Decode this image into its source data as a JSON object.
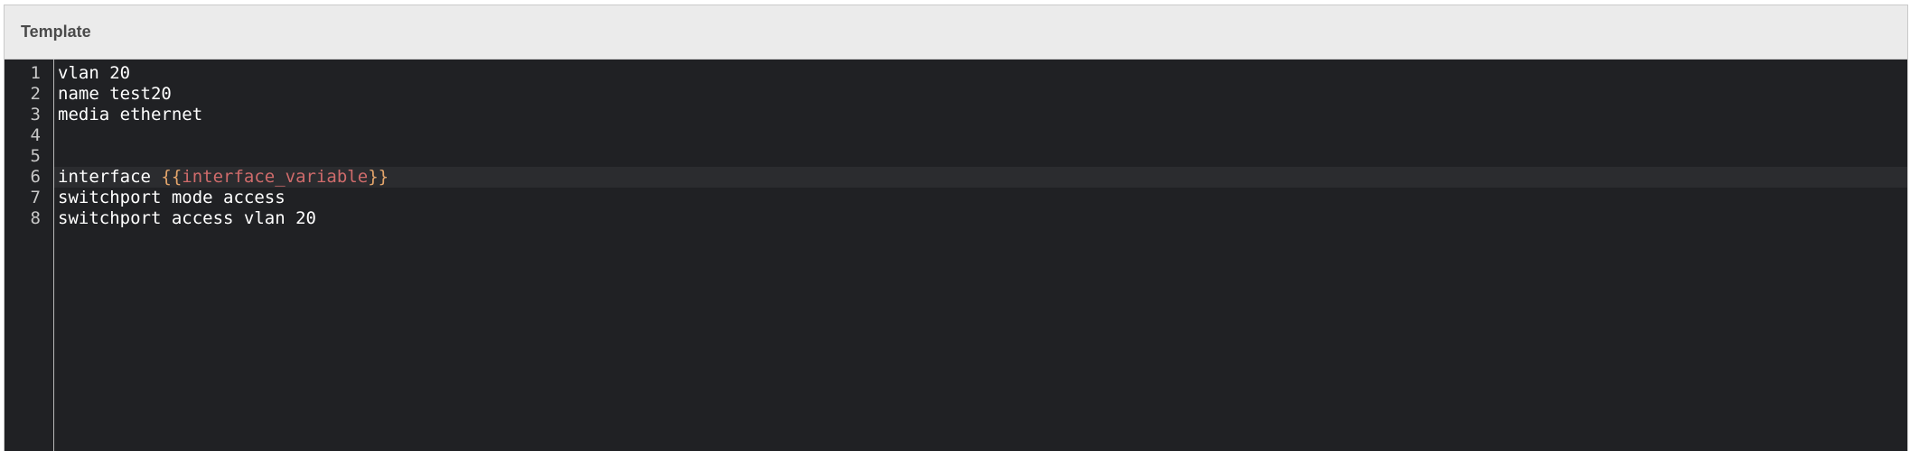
{
  "panel": {
    "title": "Template"
  },
  "editor": {
    "line_numbers": [
      "1",
      "2",
      "3",
      "4",
      "5",
      "6",
      "7",
      "8"
    ],
    "lines": {
      "l1": "vlan 20",
      "l2": "name test20",
      "l3": "media ethernet",
      "l4": "",
      "l5": "",
      "l6_prefix": "interface ",
      "l6_open": "{{",
      "l6_var": "interface_variable",
      "l6_close": "}}",
      "l7": "switchport mode access",
      "l8": "switchport access vlan 20"
    },
    "active_line": "6",
    "colors": {
      "background": "#202124",
      "text": "#ffffff",
      "template_braces": "#e3a46a",
      "template_variable": "#cf6b6b",
      "header_background": "#ebebeb"
    }
  }
}
